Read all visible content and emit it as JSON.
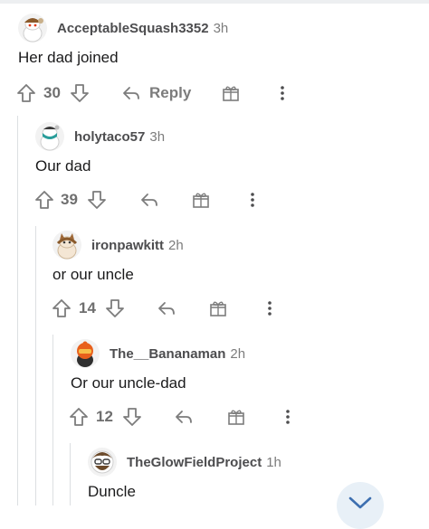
{
  "comments": [
    {
      "username": "AcceptableSquash3352",
      "age": "3h",
      "text": "Her dad joined",
      "score": "30",
      "reply_label": "Reply",
      "avatar": "snoo-avatar-brown-cap"
    },
    {
      "username": "holytaco57",
      "age": "3h",
      "text": "Our dad",
      "score": "39",
      "avatar": "snoo-avatar-teal-mask"
    },
    {
      "username": "ironpawkitt",
      "age": "2h",
      "text": "or our uncle",
      "score": "14",
      "avatar": "snoo-avatar-cat-ears"
    },
    {
      "username": "The__Bananaman",
      "age": "2h",
      "text": "Or our uncle-dad",
      "score": "12",
      "avatar": "snoo-avatar-orange-helmet"
    },
    {
      "username": "TheGlowFieldProject",
      "age": "1h",
      "text": "Duncle",
      "avatar": "snoo-avatar-glasses-beard"
    }
  ],
  "icons": {
    "upvote": "upvote-arrow-icon",
    "downvote": "downvote-arrow-icon",
    "reply": "reply-arrow-icon",
    "award": "gift-award-icon",
    "more": "more-vertical-icon",
    "fab": "chevron-down-icon"
  },
  "colors": {
    "icon_gray": "#7c7c7c",
    "text": "#1a1a1b",
    "username": "#4d4d4f",
    "thread_line": "#dcdfe2"
  }
}
